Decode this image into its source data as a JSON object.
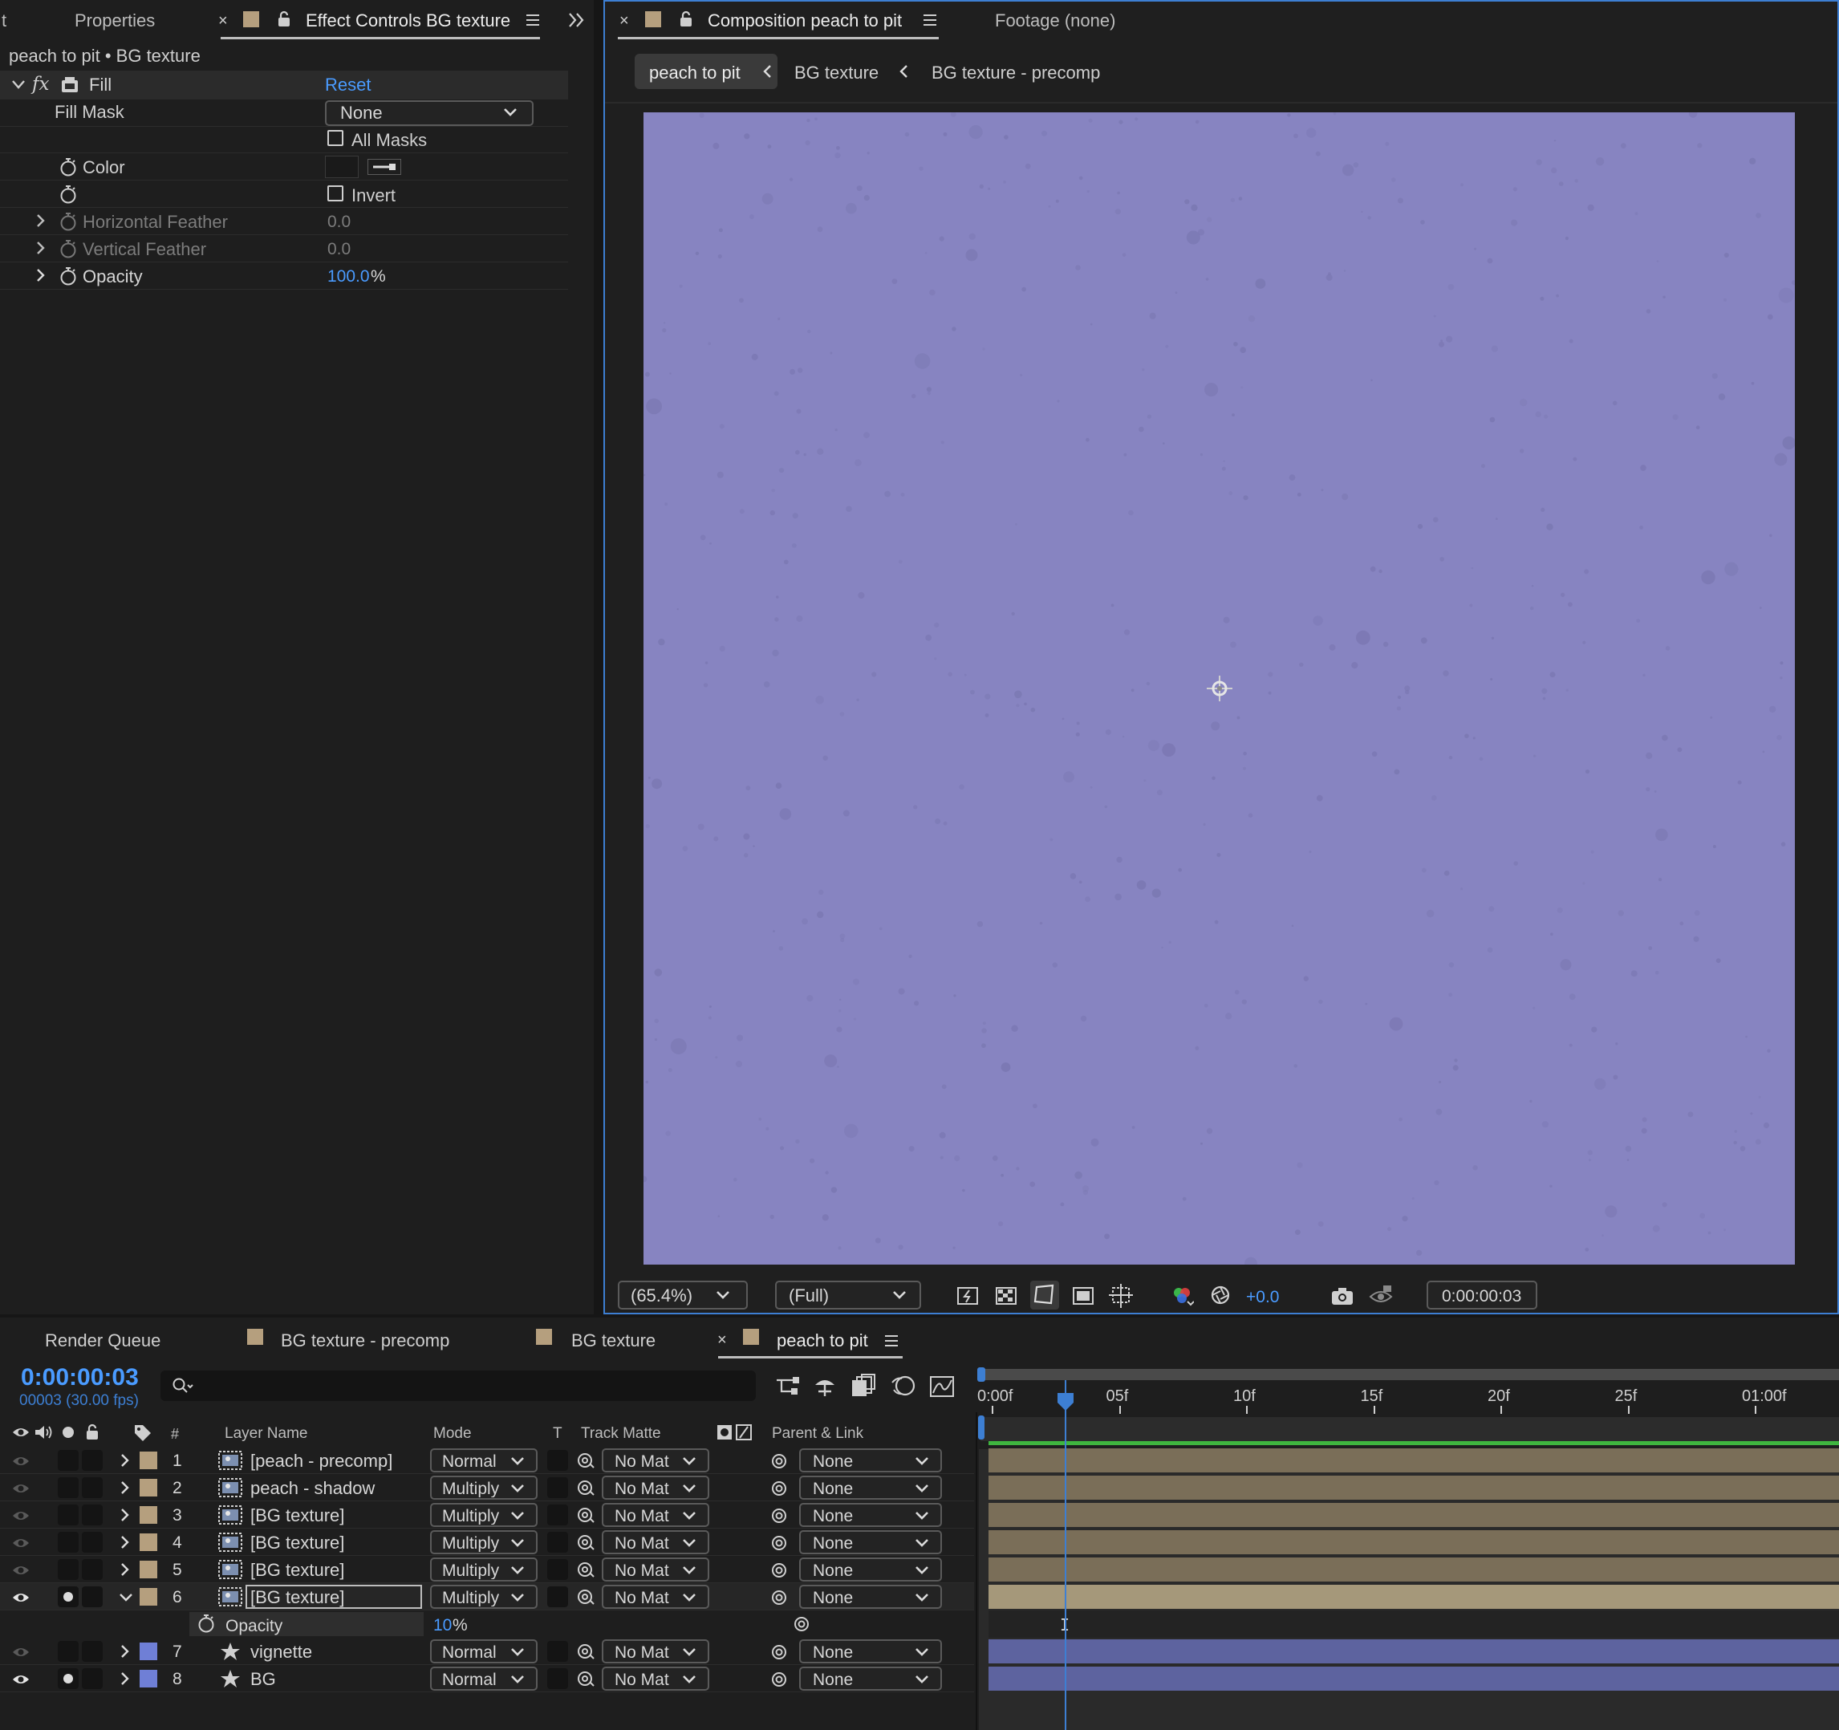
{
  "effect_panel": {
    "tab_left_fragment": "t",
    "tab_properties": "Properties",
    "tab_effect_controls": "Effect Controls BG texture",
    "subtitle": "peach to pit • BG texture",
    "effect_name": "Fill",
    "reset": "Reset",
    "fx_label": "fx",
    "props": {
      "fill_mask_label": "Fill Mask",
      "fill_mask_value": "None",
      "all_masks_label": "All Masks",
      "color_label": "Color",
      "invert_label": "Invert",
      "hfeather_label": "Horizontal Feather",
      "hfeather_value": "0.0",
      "vfeather_label": "Vertical Feather",
      "vfeather_value": "0.0",
      "opacity_label": "Opacity",
      "opacity_value": "100.0",
      "opacity_unit": "%"
    }
  },
  "comp_panel": {
    "tab_composition": "Composition peach to pit",
    "tab_footage": "Footage (none)",
    "breadcrumbs": [
      "peach to pit",
      "BG texture",
      "BG texture - precomp"
    ],
    "canvas_color": "#8784c1",
    "toolbar": {
      "zoom": "(65.4%)",
      "resolution": "(Full)",
      "exposure": "+0.0",
      "timecode": "0:00:00:03"
    }
  },
  "timeline": {
    "tabs": [
      "Render Queue",
      "BG texture - precomp",
      "BG texture",
      "peach to pit"
    ],
    "current_time": "0:00:00:03",
    "frame_info": "00003 (30.00 fps)",
    "search_placeholder": "",
    "columns": {
      "num": "#",
      "layer_name": "Layer Name",
      "mode": "Mode",
      "t": "T",
      "track_matte": "Track Matte",
      "parent": "Parent & Link"
    },
    "ruler": [
      "0:00f",
      "05f",
      "10f",
      "15f",
      "20f",
      "25f",
      "01:00f"
    ],
    "layers": [
      {
        "num": "1",
        "name": "[peach - precomp]",
        "mode": "Normal",
        "matte": "No Mat",
        "parent": "None",
        "color": "#b59f7e",
        "icon": "precomp-icon"
      },
      {
        "num": "2",
        "name": "peach - shadow",
        "mode": "Multiply",
        "matte": "No Mat",
        "parent": "None",
        "color": "#b59f7e",
        "icon": "precomp-icon"
      },
      {
        "num": "3",
        "name": "[BG texture]",
        "mode": "Multiply",
        "matte": "No Mat",
        "parent": "None",
        "color": "#b59f7e",
        "icon": "precomp-icon"
      },
      {
        "num": "4",
        "name": "[BG texture]",
        "mode": "Multiply",
        "matte": "No Mat",
        "parent": "None",
        "color": "#b59f7e",
        "icon": "precomp-icon"
      },
      {
        "num": "5",
        "name": "[BG texture]",
        "mode": "Multiply",
        "matte": "No Mat",
        "parent": "None",
        "color": "#b59f7e",
        "icon": "precomp-icon"
      },
      {
        "num": "6",
        "name": "[BG texture]",
        "mode": "Multiply",
        "matte": "No Mat",
        "parent": "None",
        "color": "#b59f7e",
        "icon": "precomp-icon"
      },
      {
        "num": "7",
        "name": "vignette",
        "mode": "Normal",
        "matte": "No Mat",
        "parent": "None",
        "color": "#6f7fd6",
        "icon": "shape-star-icon"
      },
      {
        "num": "8",
        "name": "BG",
        "mode": "Normal",
        "matte": "No Mat",
        "parent": "None",
        "color": "#6f7fd6",
        "icon": "shape-star-icon"
      }
    ],
    "opacity_prop": {
      "label": "Opacity",
      "value": "10",
      "unit": "%"
    }
  }
}
